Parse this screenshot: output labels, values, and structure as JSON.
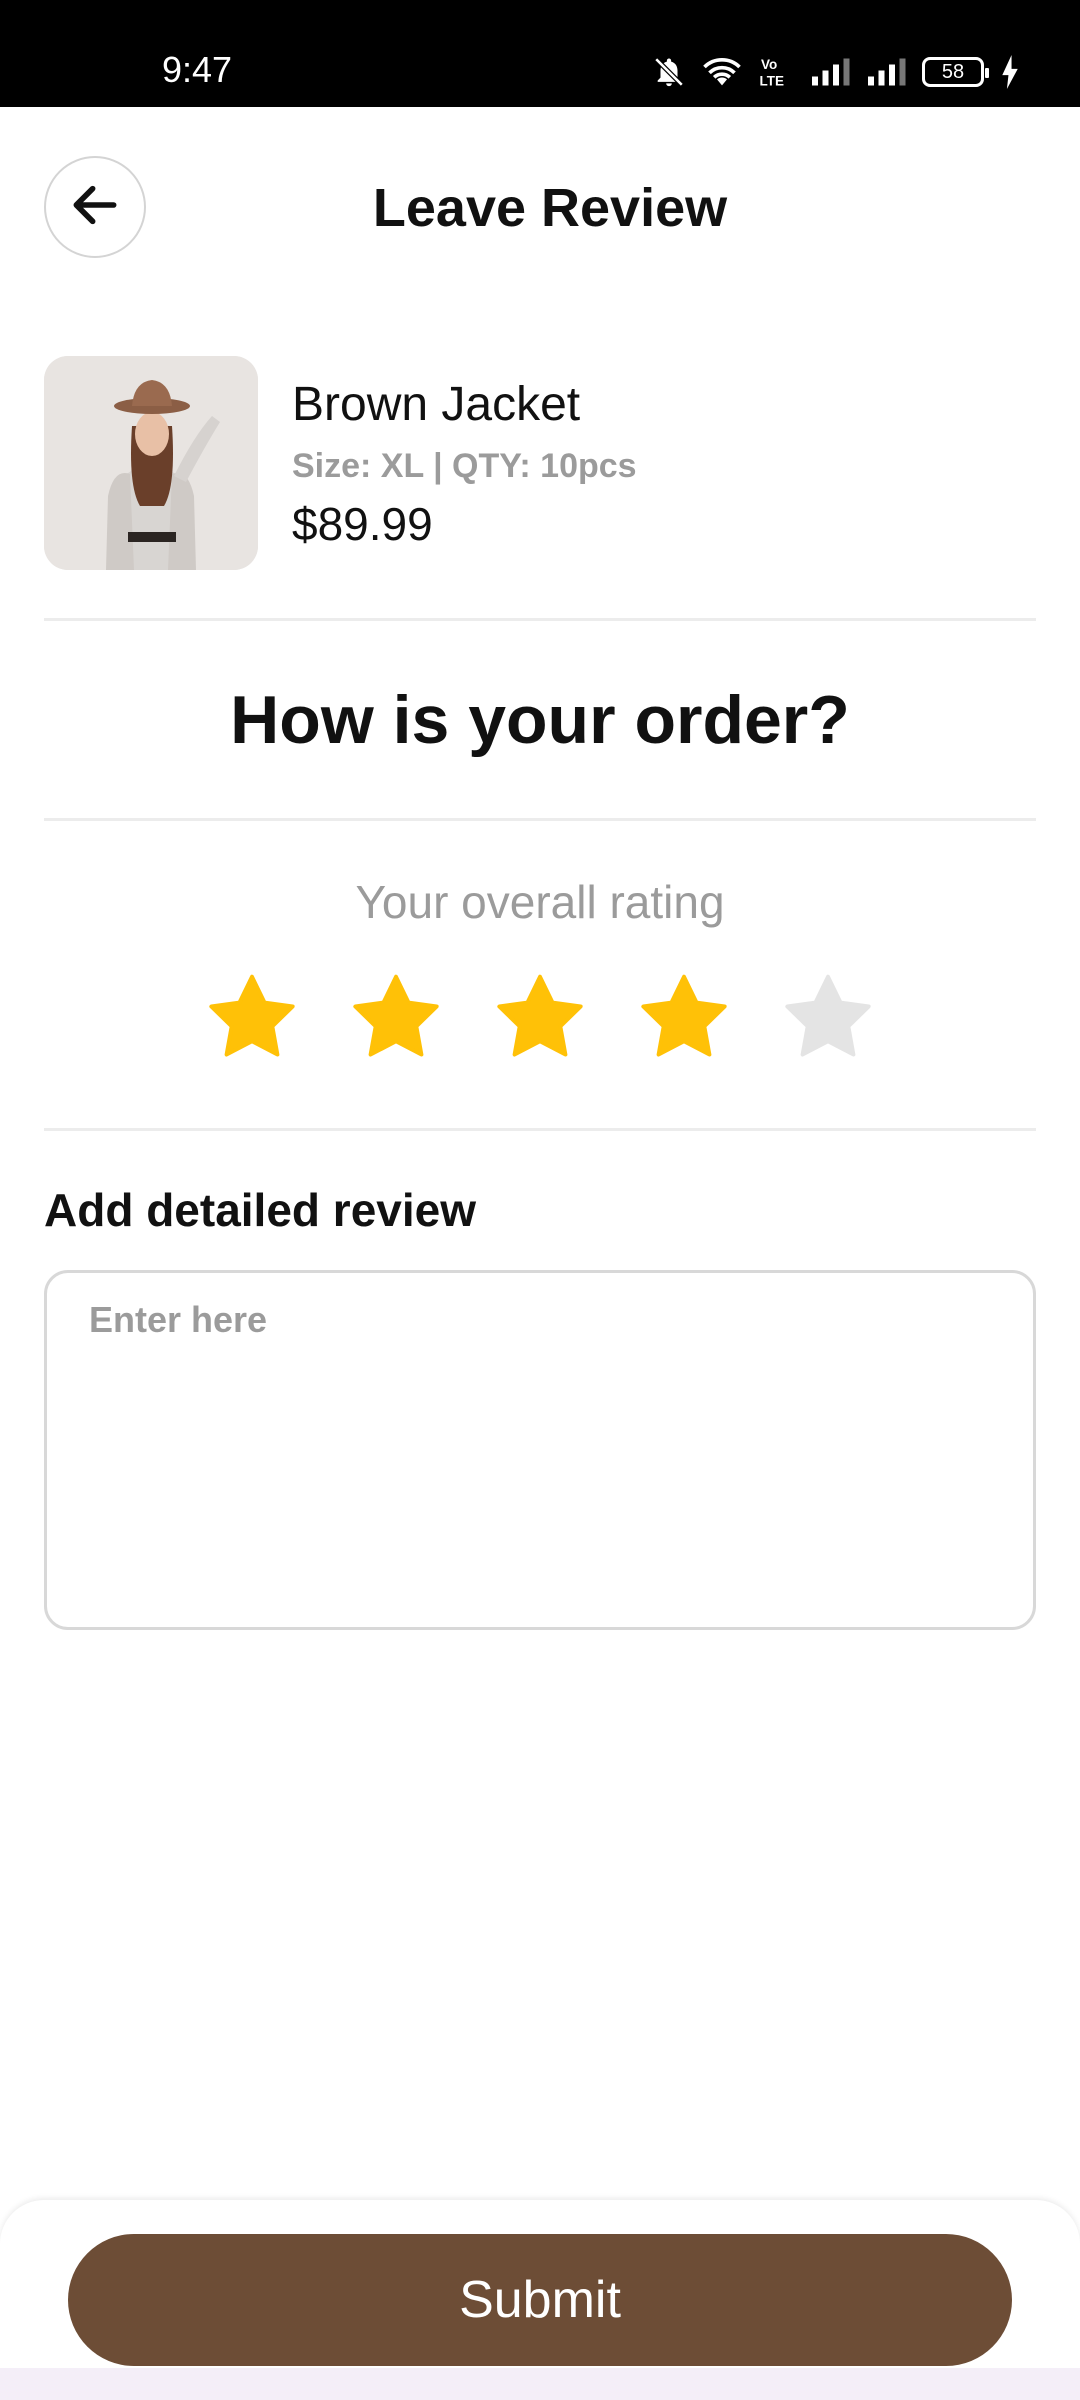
{
  "status_bar": {
    "time": "9:47",
    "battery": "58",
    "icons": [
      "notifications-off-icon",
      "wifi-icon",
      "volte-icon",
      "signal-icon",
      "signal-icon",
      "battery-icon",
      "charging-icon"
    ]
  },
  "header": {
    "title": "Leave Review",
    "back_icon": "arrow-left-icon"
  },
  "product": {
    "name": "Brown Jacket",
    "meta": "Size: XL | QTY: 10pcs",
    "price": "$89.99"
  },
  "question": "How is your order?",
  "rating": {
    "label": "Your overall rating",
    "value": 4,
    "max": 5,
    "active_color": "#FFC107",
    "inactive_color": "#E4E4E4"
  },
  "review": {
    "label": "Add detailed review",
    "placeholder": "Enter here",
    "value": ""
  },
  "submit": {
    "label": "Submit",
    "color": "#6D4D36"
  }
}
